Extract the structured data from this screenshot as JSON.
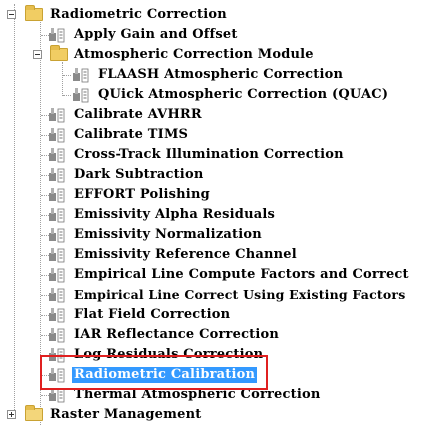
{
  "tree": {
    "radiometric_correction": "Radiometric Correction",
    "apply_gain_offset": "Apply Gain and Offset",
    "atmospheric_module": "Atmospheric Correction Module",
    "flaash": "FLAASH Atmospheric Correction",
    "quac": "QUick Atmospheric Correction (QUAC)",
    "calibrate_avhrr": "Calibrate AVHRR",
    "calibrate_tims": "Calibrate TIMS",
    "cross_track": "Cross-Track Illumination Correction",
    "dark_subtraction": "Dark Subtraction",
    "effort": "EFFORT Polishing",
    "emissivity_alpha": "Emissivity Alpha Residuals",
    "emissivity_norm": "Emissivity Normalization",
    "emissivity_ref": "Emissivity Reference Channel",
    "empirical_compute": "Empirical Line Compute Factors and Correct",
    "empirical_existing": "Empirical Line Correct Using Existing Factors",
    "flat_field": "Flat Field Correction",
    "iar": "IAR Reflectance Correction",
    "log_residuals": "Log Residuals Correction",
    "radiometric_calibration": "Radiometric Calibration",
    "thermal_atmospheric": "Thermal Atmospheric Correction",
    "raster_management": "Raster Management"
  },
  "colors": {
    "selection": "#3399ff",
    "highlight_box": "#e02020",
    "folder": "#f1cd63"
  }
}
